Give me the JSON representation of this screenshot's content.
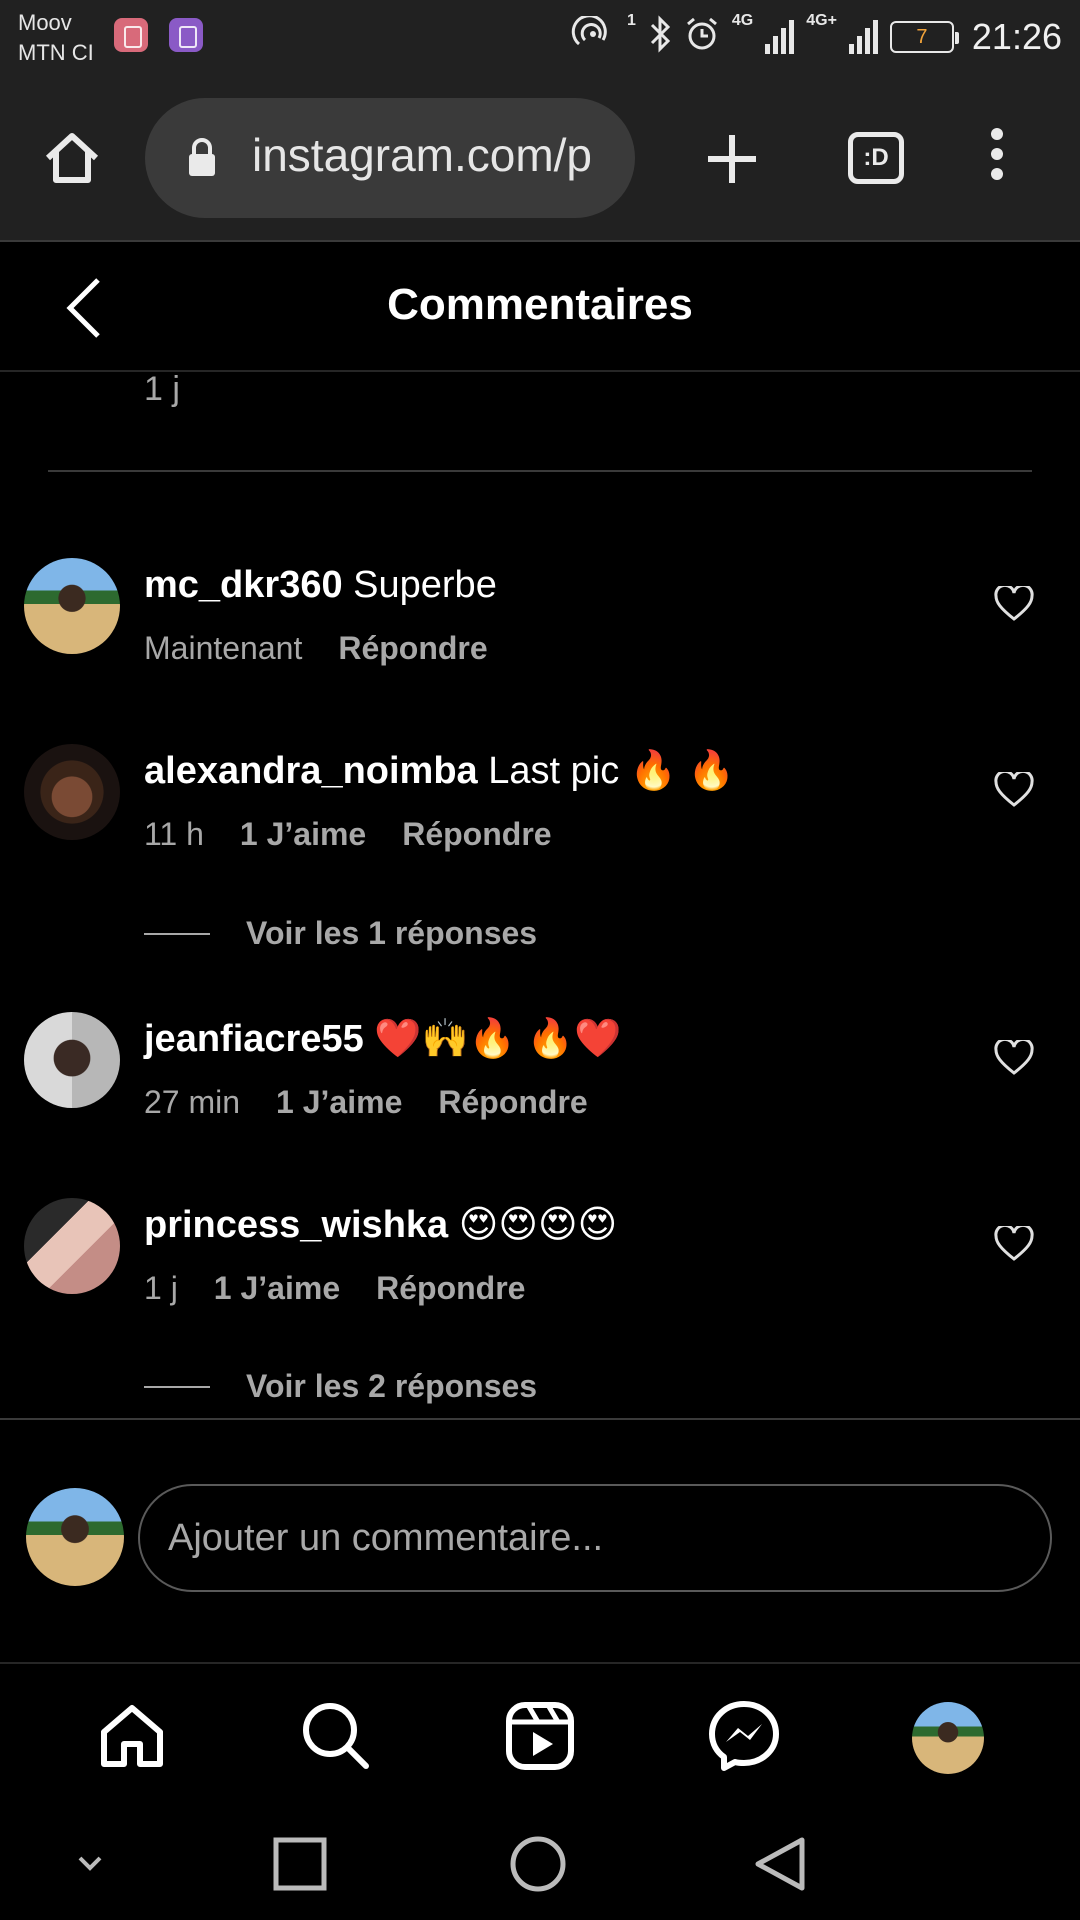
{
  "status_bar": {
    "carrier_1": "Moov",
    "carrier_2": "MTN CI",
    "hotspot_count": "1",
    "network_1": "4G",
    "network_2": "4G+",
    "battery_level": "7",
    "time": "21:26"
  },
  "browser": {
    "url": "instagram.com/p",
    "tabs_label": ":D"
  },
  "header": {
    "title": "Commentaires"
  },
  "previous_comment": {
    "time": "1 j"
  },
  "comments": [
    {
      "username": "mc_dkr360",
      "text": "Superbe",
      "time": "Maintenant",
      "likes": "",
      "reply_label": "Répondre"
    },
    {
      "username": "alexandra_noimba",
      "text": "Last pic 🔥 🔥",
      "time": "11 h",
      "likes": "1 J’aime",
      "reply_label": "Répondre",
      "view_replies": "Voir les 1 réponses"
    },
    {
      "username": "jeanfiacre55",
      "text": "❤️🙌🔥 🔥❤️",
      "time": "27 min",
      "likes": "1 J’aime",
      "reply_label": "Répondre"
    },
    {
      "username": "princess_wishka",
      "text": "😍😍😍😍",
      "time": "1 j",
      "likes": "1 J’aime",
      "reply_label": "Répondre",
      "view_replies": "Voir les 2 réponses"
    }
  ],
  "add_comment": {
    "placeholder": "Ajouter un commentaire..."
  },
  "icons": {
    "nav": [
      "home-icon",
      "search-icon",
      "reels-icon",
      "messenger-icon",
      "profile-avatar"
    ],
    "system": [
      "chevron-down-icon",
      "recents-icon",
      "home-circle-icon",
      "back-triangle-icon"
    ]
  }
}
